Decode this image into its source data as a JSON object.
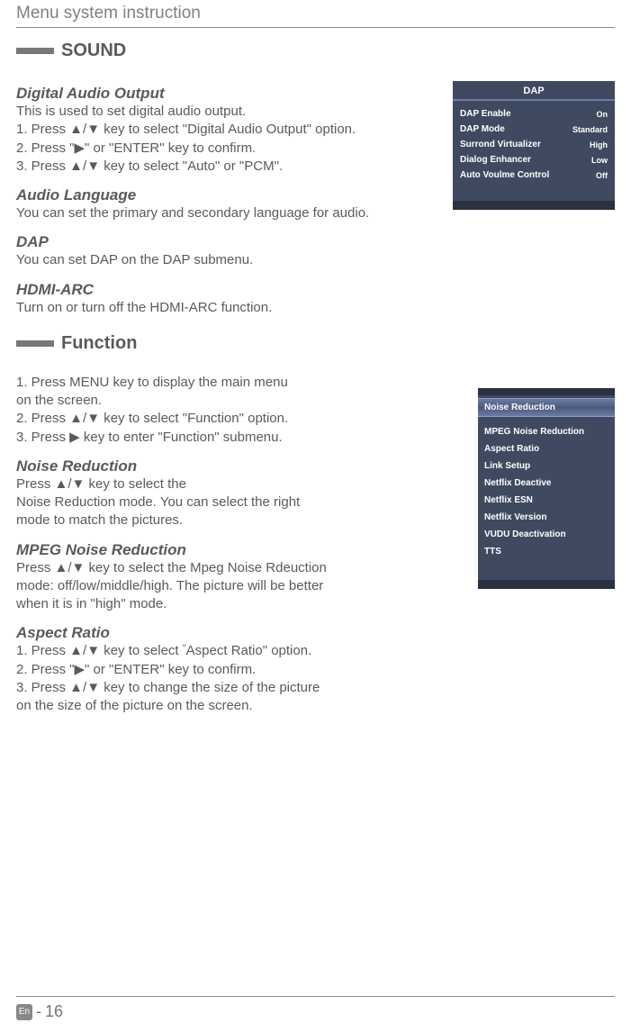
{
  "header": {
    "title": "Menu system instruction"
  },
  "sound": {
    "section_label": "SOUND",
    "dao": {
      "heading": "Digital Audio Output",
      "line1": "This is used to  set  digital  audio  output.",
      "line2": "1. Press ▲/▼ key to select \"Digital  Audio  Output\" option.",
      "line3": "2. Press \"▶\" or \"ENTER\" key to confirm.",
      "line4": "3. Press ▲/▼ key to select  \"Auto\" or \"PCM\"."
    },
    "audio_lang": {
      "heading": "Audio Language",
      "text": "You can set the primary and secondary language for audio."
    },
    "dap": {
      "heading": "DAP",
      "text": "You  can  set  DAP  on  the  DAP  submenu."
    },
    "hdmi": {
      "heading": "HDMI-ARC",
      "text": "Turn on or turn off the HDMI-ARC function."
    }
  },
  "dap_panel": {
    "title": "DAP",
    "rows": [
      {
        "label": "DAP  Enable",
        "value": "On"
      },
      {
        "label": "DAP  Mode",
        "value": "Standard"
      },
      {
        "label": "Surrond  Virtualizer",
        "value": "High"
      },
      {
        "label": "Dialog  Enhancer",
        "value": "Low"
      },
      {
        "label": "Auto Voulme  Control",
        "value": "Off"
      }
    ]
  },
  "function": {
    "section_label": "Function",
    "intro": {
      "l1": "1. Press MENU key to display the main menu",
      "l2": "    on the screen.",
      "l3": "2. Press  ▲/▼ key to select \"Function\" option.",
      "l4": "3. Press ▶ key to enter \"Function\" submenu."
    },
    "noise": {
      "heading": "Noise Reduction",
      "l1": "Press ▲/▼ key to select the",
      "l2": "Noise Reduction mode. You can select the right",
      "l3": "mode to match the pictures."
    },
    "mpeg": {
      "heading": "MPEG Noise Reduction",
      "l1": "Press ▲/▼ key to select the Mpeg Noise Rdeuction",
      "l2": "mode: off/low/middle/high. The picture will be better",
      "l3": "when it is in \"high\" mode."
    },
    "aspect": {
      "heading": "Aspect Ratio",
      "l1_pre": "1. Press ▲/▼ key to select ",
      "l1_q": "\"",
      "l1_post": "Aspect Ratio\"  option.",
      "l2": "2. Press \"▶\" or \"ENTER\" key to confirm.",
      "l3": "3. Press ▲/▼ key to change the size of the picture",
      "l4": "    on the size of the picture on the screen."
    }
  },
  "func_panel": {
    "highlight": "Noise Reduction",
    "items": [
      "MPEG Noise Reduction",
      "Aspect Ratio",
      "Link  Setup",
      "Netflix Deactive",
      "Netflix ESN",
      "Netflix Version",
      "VUDU Deactivation",
      "TTS"
    ]
  },
  "footer": {
    "lang": "En",
    "dash": "-",
    "page": "16"
  }
}
